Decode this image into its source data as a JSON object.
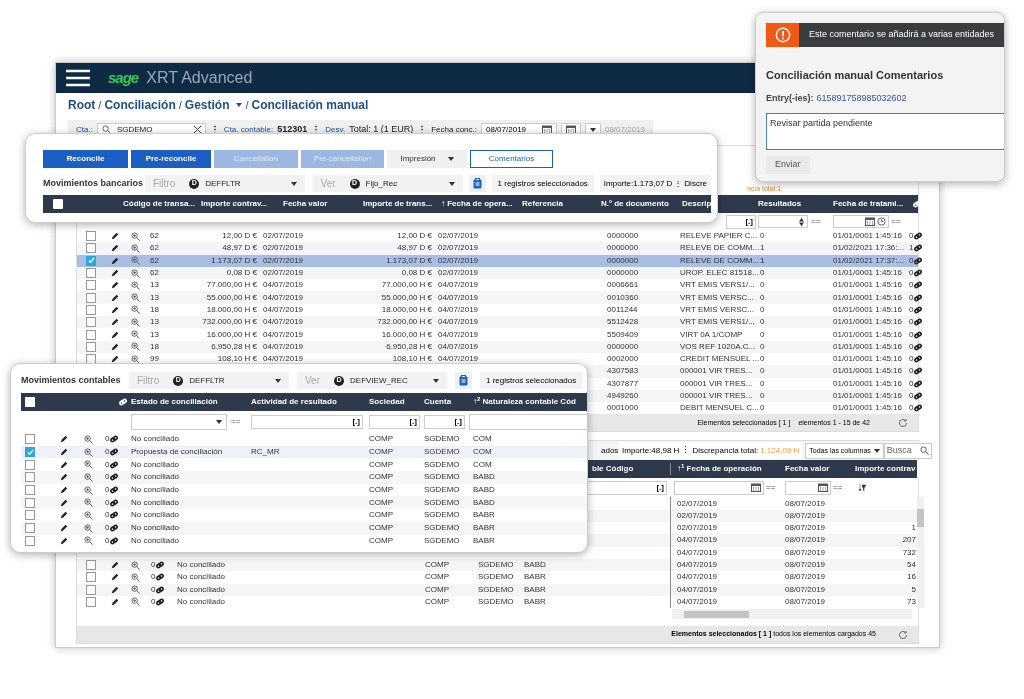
{
  "app": {
    "logo": "sage",
    "title": "XRT Advanced"
  },
  "breadcrumb": [
    {
      "label": "Root",
      "dropdown": false,
      "separator": "/"
    },
    {
      "label": "Conciliación",
      "dropdown": false,
      "separator": "/"
    },
    {
      "label": "Gestión",
      "dropdown": true,
      "separator": "/"
    },
    {
      "label": "Conciliación manual",
      "dropdown": false
    }
  ],
  "account_bar": {
    "cta_label": "Cta.:",
    "cta_value": "SGDEMO",
    "dividers": [
      "⋮",
      "⋮",
      "⋮"
    ],
    "contable_label": "Cta. contable:",
    "contable_value": "512301",
    "desv_label": "Desv.",
    "total": "Total: 1 (1 EUR)",
    "fecha_label": "Fecha conc.:",
    "fecha_value": "08/07/2019",
    "fecha_hint": "08/07/2019"
  },
  "bank_table": {
    "summary_partial": "ncia total:1.",
    "columns": [
      "Resultados",
      "Fecha de tratami..."
    ],
    "filters": [
      {
        "kind": "text",
        "symbol": "[.]"
      },
      {
        "kind": "number",
        "symbol": "=="
      },
      {
        "kind": "datetime",
        "symbol": "=="
      }
    ],
    "rows": [
      {
        "selected": false,
        "code": "62",
        "contra": "12,00 D €",
        "fvalor": "02/07/2019",
        "trans": "12,00 D €",
        "fop": "02/07/2019",
        "doc": "0000000",
        "desc": "RELEVE PAPIER C...",
        "res": "0",
        "ftrat": "01/01/0001 1:45:16",
        "links": "0"
      },
      {
        "selected": false,
        "code": "62",
        "contra": "48,97 D €",
        "fvalor": "02/07/2019",
        "trans": "48,97 D €",
        "fop": "02/07/2019",
        "doc": "0000000",
        "desc": "RELEVE DE COMM...",
        "res": "1",
        "ftrat": "01/02/2021 17:36:...",
        "links": "1"
      },
      {
        "selected": true,
        "code": "62",
        "contra": "1.173,07 D €",
        "fvalor": "02/07/2019",
        "trans": "1.173,07 D €",
        "fop": "02/07/2019",
        "doc": "0000000",
        "desc": "RELEVE DE COMM...",
        "res": "1",
        "ftrat": "01/02/2021 17:37:...",
        "links": "0"
      },
      {
        "selected": false,
        "code": "62",
        "contra": "0,08 D €",
        "fvalor": "02/07/2019",
        "trans": "0,08 D €",
        "fop": "02/07/2019",
        "doc": "0000000",
        "desc": "UROP. ELEC 81518...",
        "res": "0",
        "ftrat": "01/01/0001 1:45:16",
        "links": "0"
      },
      {
        "selected": false,
        "code": "13",
        "contra": "77.000,00 H €",
        "fvalor": "04/07/2019",
        "trans": "77.000,00 H €",
        "fop": "04/07/2019",
        "doc": "0006661",
        "desc": "VRT EMIS VERS1/...",
        "res": "0",
        "ftrat": "01/01/0001 1:45:16",
        "links": "0"
      },
      {
        "selected": false,
        "code": "13",
        "contra": "55.000,00 H €",
        "fvalor": "04/07/2019",
        "trans": "55.000,00 H €",
        "fop": "04/07/2019",
        "doc": "0010360",
        "desc": "VRT EMIS VERSC...",
        "res": "0",
        "ftrat": "01/01/0001 1:45:16",
        "links": "0"
      },
      {
        "selected": false,
        "code": "18",
        "contra": "18.000,00 H €",
        "fvalor": "04/07/2019",
        "trans": "18.000,00 H €",
        "fop": "04/07/2019",
        "doc": "0011244",
        "desc": "VRT EMIS VERSC...",
        "res": "0",
        "ftrat": "01/01/0001 1:45:16",
        "links": "0"
      },
      {
        "selected": false,
        "code": "13",
        "contra": "732.000,00 H €",
        "fvalor": "04/07/2019",
        "trans": "732.000,00 H €",
        "fop": "04/07/2019",
        "doc": "5512428",
        "desc": "VRT EMIS VERS1/...",
        "res": "0",
        "ftrat": "01/01/0001 1:45:16",
        "links": "0"
      },
      {
        "selected": false,
        "code": "13",
        "contra": "16.000,00 H €",
        "fvalor": "04/07/2019",
        "trans": "16.000,00 H €",
        "fop": "04/07/2019",
        "doc": "5509409",
        "desc": "VIRT 0A 1/COMP",
        "res": "0",
        "ftrat": "01/01/0001 1:45:16",
        "links": "0"
      },
      {
        "selected": false,
        "code": "18",
        "contra": "6.950,28 H €",
        "fvalor": "04/07/2019",
        "trans": "6.950,28 H €",
        "fop": "04/07/2019",
        "doc": "0000000",
        "desc": "VOS REF 1020A.C...",
        "res": "0",
        "ftrat": "01/01/0001 1:45:16",
        "links": "0"
      },
      {
        "selected": false,
        "code": "99",
        "contra": "108,10 H €",
        "fvalor": "04/07/2019",
        "trans": "108,10 H €",
        "fop": "04/07/2019",
        "doc": "0002000",
        "desc": "CREDIT MENSUEL ...",
        "res": "0",
        "ftrat": "01/01/0001 1:45:16",
        "links": "0"
      },
      {
        "doc": "4307583",
        "desc": "000001 VIR TRES...",
        "res": "0",
        "ftrat": "01/01/0001 1:45:16",
        "links": "0"
      },
      {
        "doc": "4307877",
        "desc": "000001 VIR TRES...",
        "res": "0",
        "ftrat": "01/01/0001 1:45:16",
        "links": "0"
      },
      {
        "doc": "4949260",
        "desc": "000001 VIR TRES...",
        "res": "0",
        "ftrat": "01/01/0001 1:45:16",
        "links": "0"
      },
      {
        "doc": "0001000",
        "desc": "DEBIT MENSUEL C...",
        "res": "0",
        "ftrat": "01/01/0001 1:45:16",
        "links": "0"
      }
    ],
    "footer": {
      "selected": "Elementos seleccionados [ 1 ]",
      "range": "elementos 1 - 15 de 42"
    }
  },
  "accounting_bar": {
    "selected_partial": "ados",
    "importe": "Importe:48,98 H",
    "separator": "⋮",
    "discrepancia_label": "Discrepancia total:",
    "discrepancia_value": "1.124,09 H",
    "columns_select": "Todas las columnas",
    "search_placeholder": "Busca"
  },
  "accounting_table": {
    "columns": [
      "ble Código",
      "↑$^{1}$ Fecha de operación",
      "Fecha valor",
      "Importe contrav"
    ],
    "filters": [
      {
        "kind": "text",
        "symbol": "[.]"
      },
      {
        "kind": "date",
        "symbol": "=="
      },
      {
        "kind": "date",
        "symbol": "=="
      },
      {
        "kind": "sort"
      }
    ],
    "rows": [
      {
        "fop": "02/07/2019",
        "fvalor": "08/07/2019"
      },
      {
        "fop": "02/07/2019",
        "fvalor": "08/07/2019"
      },
      {
        "fop": "02/07/2019",
        "fvalor": "08/07/2019",
        "importe": "1"
      },
      {
        "fop": "04/07/2019",
        "fvalor": "08/07/2019",
        "importe": "207"
      },
      {
        "fop": "04/07/2019",
        "fvalor": "08/07/2019",
        "importe": "732"
      },
      {
        "checked": false,
        "links": "0",
        "status": "No conciliado",
        "sociedad": "COMP",
        "cuenta": "SGDEMO",
        "naturaleza": "BABD",
        "fop": "04/07/2019",
        "fvalor": "08/07/2019",
        "importe": "54"
      },
      {
        "checked": false,
        "links": "0",
        "status": "No conciliado",
        "sociedad": "COMP",
        "cuenta": "SGDEMO",
        "naturaleza": "BABR",
        "fop": "04/07/2019",
        "fvalor": "08/07/2019",
        "importe": "16"
      },
      {
        "checked": false,
        "links": "0",
        "status": "No conciliado",
        "sociedad": "COMP",
        "cuenta": "SGDEMO",
        "naturaleza": "BABR",
        "fop": "04/07/2019",
        "fvalor": "08/07/2019",
        "importe": "5"
      },
      {
        "checked": false,
        "links": "0",
        "status": "No conciliado",
        "sociedad": "COMP",
        "cuenta": "SGDEMO",
        "naturaleza": "BABR",
        "fop": "04/07/2019",
        "fvalor": "08/07/2019",
        "importe": "73"
      }
    ],
    "footer": {
      "selected": "Elementos seleccionados [ 1 ]",
      "loaded": "todos los elementos cargados 45"
    }
  },
  "action_panel": {
    "buttons": [
      {
        "label": "Reconcile",
        "kind": "primary"
      },
      {
        "label": "Pre-reconcile",
        "kind": "primary"
      },
      {
        "label": "Cancellation",
        "kind": "disabled"
      },
      {
        "label": "Pre-cancellation",
        "kind": "disabled"
      },
      {
        "label": "Impresión",
        "kind": "menu"
      },
      {
        "label": "Comentarios",
        "kind": "outline"
      }
    ],
    "title": "Movimientos bancarios",
    "filter": {
      "label": "Filtro",
      "badge": "D",
      "value": "DEFFLTR"
    },
    "view": {
      "label": "Ver",
      "badge": "D",
      "value": "Fijo_Rec"
    },
    "selected_count": "1 registros seleccionados",
    "importe": "Importe:1.173,07 D",
    "separator": "⋮",
    "discrepancia_partial": "Discre",
    "header_checked": false,
    "columns": [
      "Código de transa...",
      "Importe contrav...",
      "Fecha valor",
      "Importe de trans...",
      "↑ Fecha de opera...",
      "Referencia",
      "N.º de documento",
      "Descrip"
    ]
  },
  "accounting_panel": {
    "title": "Movimientos contables",
    "filter": {
      "label": "Filtro",
      "badge": "D",
      "value": "DEFFLTR"
    },
    "view": {
      "label": "Ver",
      "badge": "D",
      "value": "DEFVIEW_REC"
    },
    "selected_count": "1 registros seleccionados",
    "header_checked": false,
    "columns": [
      "Estado de conciliación",
      "Actividad de resultado",
      "Sociedad",
      "Cuenta",
      "↑$^{2}$ Naturaleza contable Cód"
    ],
    "filters": [
      {
        "kind": "select",
        "symbol": "=="
      },
      {
        "kind": "text",
        "symbol": "[.]"
      },
      {
        "kind": "text",
        "symbol": "[.]"
      },
      {
        "kind": "text",
        "symbol": "[.]"
      },
      {
        "kind": "blank"
      }
    ],
    "rows": [
      {
        "checked": false,
        "links": "0",
        "status": "No conciliado",
        "sociedad": "COMP",
        "cuenta": "SGDEMO",
        "naturaleza": "COM"
      },
      {
        "checked": true,
        "links": "0",
        "status": "Propuesta de conciliación",
        "actividad": "RC_MR",
        "sociedad": "COMP",
        "cuenta": "SGDEMO",
        "naturaleza": "COM"
      },
      {
        "checked": false,
        "links": "0",
        "status": "No conciliado",
        "sociedad": "COMP",
        "cuenta": "SGDEMO",
        "naturaleza": "COM"
      },
      {
        "checked": false,
        "links": "0",
        "status": "No conciliado",
        "sociedad": "COMP",
        "cuenta": "SGDEMO",
        "naturaleza": "BABD"
      },
      {
        "checked": false,
        "links": "0",
        "status": "No conciliado",
        "sociedad": "COMP",
        "cuenta": "SGDEMO",
        "naturaleza": "BABD"
      },
      {
        "checked": false,
        "links": "0",
        "status": "No conciliado",
        "sociedad": "COMP",
        "cuenta": "SGDEMO",
        "naturaleza": "BABD"
      },
      {
        "checked": false,
        "links": "0",
        "status": "No conciliado",
        "sociedad": "COMP",
        "cuenta": "SGDEMO",
        "naturaleza": "BABR"
      },
      {
        "checked": false,
        "links": "0",
        "status": "No conciliado",
        "sociedad": "COMP",
        "cuenta": "SGDEMO",
        "naturaleza": "BABR"
      },
      {
        "checked": false,
        "links": "0",
        "status": "No conciliado",
        "sociedad": "COMP",
        "cuenta": "SGDEMO",
        "naturaleza": "BABR"
      }
    ]
  },
  "comment_dialog": {
    "banner": "Este comentario se añadirá a varias entidades",
    "title": "Conciliación manual Comentarios",
    "entry_label": "Entry(-ies):",
    "entry_value": "615891758985032602",
    "comment": "Revisar partida pendiente",
    "button": "Enviar"
  }
}
